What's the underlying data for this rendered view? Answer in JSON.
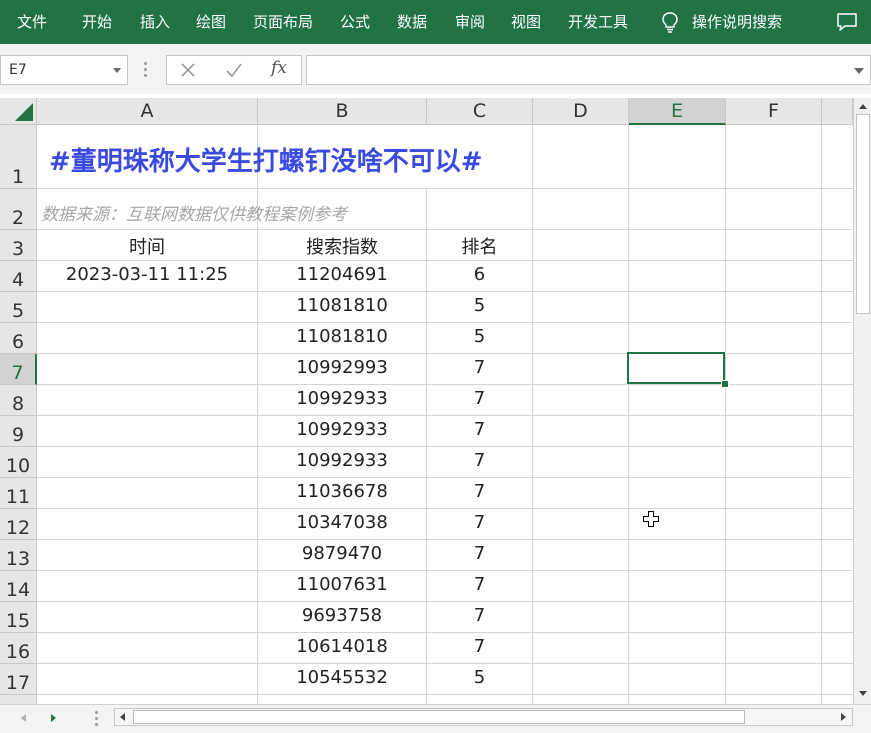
{
  "ribbon": {
    "menu": [
      "文件",
      "开始",
      "插入",
      "绘图",
      "页面布局",
      "公式",
      "数据",
      "审阅",
      "视图",
      "开发工具"
    ],
    "search": "操作说明搜索",
    "bg_color": "#217346"
  },
  "formula_bar": {
    "name_box": "E7",
    "cancel_icon": "x-icon",
    "enter_icon": "check-icon",
    "function_label": "fx",
    "value": ""
  },
  "sheet": {
    "columns": [
      "A",
      "B",
      "C",
      "D",
      "E",
      "F"
    ],
    "active_column": "E",
    "rows": [
      "1",
      "2",
      "3",
      "4",
      "5",
      "6",
      "7",
      "8",
      "9",
      "10",
      "11",
      "12",
      "13",
      "14",
      "15",
      "16",
      "17"
    ],
    "active_row": "7",
    "selected_cell": "E7",
    "title": "#董明珠称大学生打螺钉没啥不可以#",
    "title_color": "#3b4be0",
    "source_note": "数据来源：互联网数据仅供教程案例参考",
    "headers": {
      "time": "时间",
      "index": "搜索指数",
      "rank": "排名"
    },
    "records": [
      {
        "time": "2023-03-11 11:25",
        "index": "11204691",
        "rank": "6"
      },
      {
        "time": "",
        "index": "11081810",
        "rank": "5"
      },
      {
        "time": "",
        "index": "11081810",
        "rank": "5"
      },
      {
        "time": "",
        "index": "10992993",
        "rank": "7"
      },
      {
        "time": "",
        "index": "10992933",
        "rank": "7"
      },
      {
        "time": "",
        "index": "10992933",
        "rank": "7"
      },
      {
        "time": "",
        "index": "10992933",
        "rank": "7"
      },
      {
        "time": "",
        "index": "11036678",
        "rank": "7"
      },
      {
        "time": "",
        "index": "10347038",
        "rank": "7"
      },
      {
        "time": "",
        "index": "9879470",
        "rank": "7"
      },
      {
        "time": "",
        "index": "11007631",
        "rank": "7"
      },
      {
        "time": "",
        "index": "9693758",
        "rank": "7"
      },
      {
        "time": "",
        "index": "10614018",
        "rank": "7"
      },
      {
        "time": "",
        "index": "10545532",
        "rank": "5"
      }
    ]
  }
}
